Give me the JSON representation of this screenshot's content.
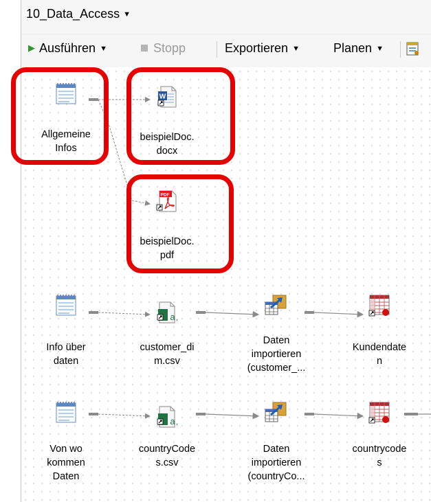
{
  "window": {
    "title": "10_Data_Access"
  },
  "toolbar": {
    "run": "Ausführen",
    "stop": "Stopp",
    "export": "Exportieren",
    "schedule": "Planen"
  },
  "nodes": {
    "general_info": {
      "line1": "Allgemeine",
      "line2": "Infos",
      "icon": "note-icon"
    },
    "doc_docx": {
      "line1": "beispielDoc.",
      "line2": "docx",
      "icon": "word-document-icon"
    },
    "doc_pdf": {
      "line1": "beispielDoc.",
      "line2": "pdf",
      "icon": "pdf-document-icon"
    },
    "info_data": {
      "line1": "Info über",
      "line2": "daten",
      "icon": "note-icon"
    },
    "customer_csv": {
      "line1": "customer_di",
      "line2": "m.csv",
      "icon": "csv-file-icon"
    },
    "import_customer": {
      "line1": "Daten",
      "line2": "importieren",
      "line3": "(customer_...",
      "icon": "import-data-icon"
    },
    "kundendaten": {
      "line1": "Kundendate",
      "line2": "n",
      "icon": "data-table-icon"
    },
    "von_wo": {
      "line1": "Von wo",
      "line2": "kommen",
      "line3": "Daten",
      "icon": "note-icon"
    },
    "countrycodes_csv": {
      "line1": "countryCode",
      "line2": "s.csv",
      "icon": "csv-file-icon"
    },
    "import_country": {
      "line1": "Daten",
      "line2": "importieren",
      "line3": "(countryCo...",
      "icon": "import-data-icon"
    },
    "countrycodes_table": {
      "line1": "countrycode",
      "line2": "s",
      "icon": "data-table-icon"
    }
  },
  "colors": {
    "highlight": "#e60000",
    "run_green": "#2e9a2e",
    "link_gray": "#8a8a8a"
  }
}
